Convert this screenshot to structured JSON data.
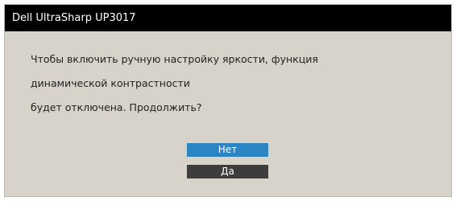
{
  "dialog": {
    "title": "Dell UltraSharp UP3017",
    "message_lines": [
      "Чтобы включить ручную настройку яркости, функция",
      "динамической контрастности",
      "будет отключена. Продолжить?"
    ],
    "buttons": {
      "no_label": "Нет",
      "yes_label": "Да"
    }
  },
  "colors": {
    "titlebar_bg": "#000000",
    "panel_bg": "#d7d3cb",
    "selected_button": "#2b85c2",
    "unselected_button": "#3d3d3d"
  }
}
